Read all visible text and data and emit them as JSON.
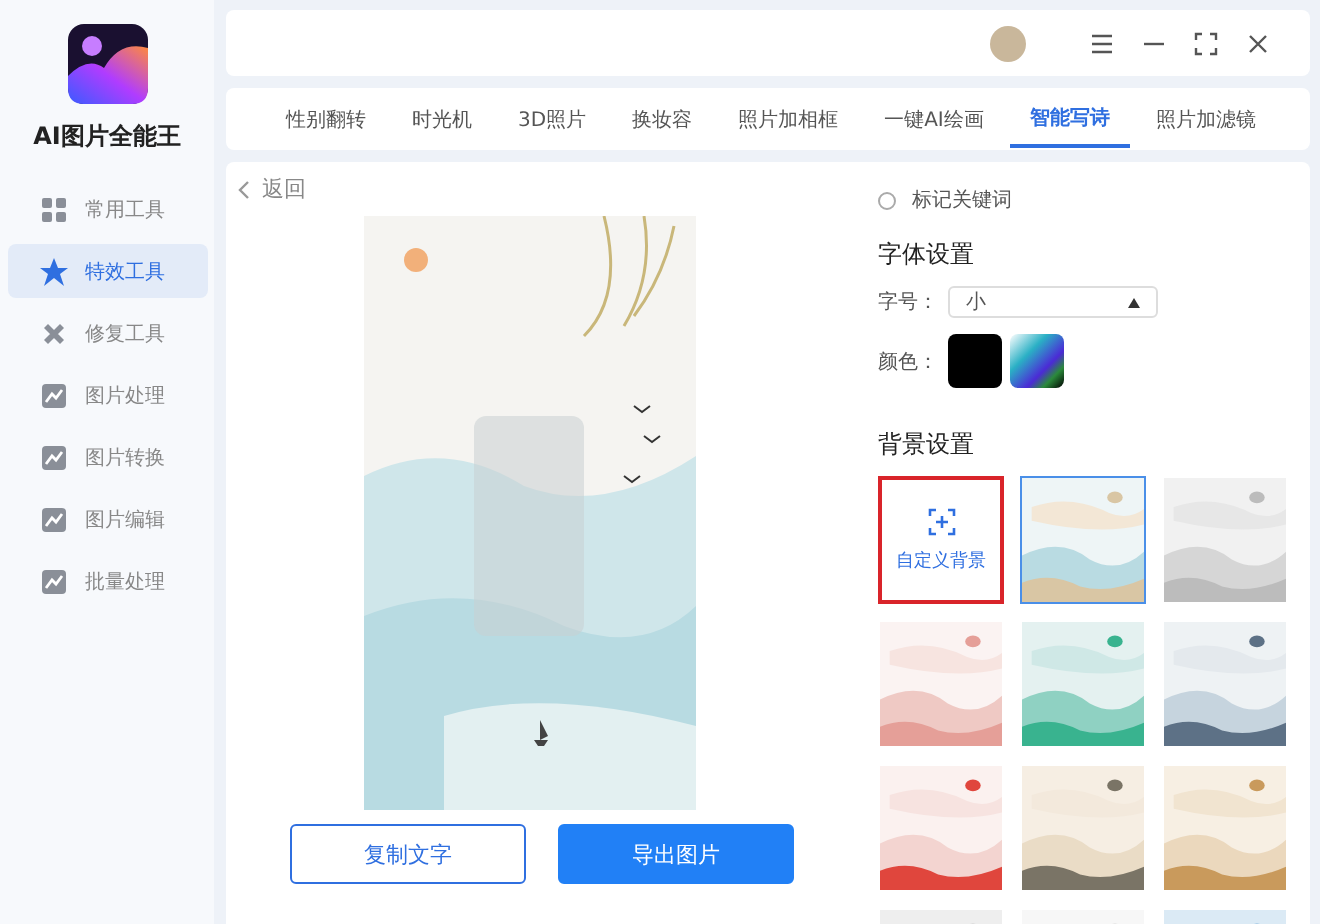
{
  "app": {
    "title": "AI图片全能王"
  },
  "sidebar": {
    "items": [
      {
        "label": "常用工具",
        "selected": false
      },
      {
        "label": "特效工具",
        "selected": true
      },
      {
        "label": "修复工具",
        "selected": false
      },
      {
        "label": "图片处理",
        "selected": false
      },
      {
        "label": "图片转换",
        "selected": false
      },
      {
        "label": "图片编辑",
        "selected": false
      },
      {
        "label": "批量处理",
        "selected": false
      }
    ]
  },
  "tabs": [
    {
      "label": "性别翻转",
      "selected": false
    },
    {
      "label": "时光机",
      "selected": false
    },
    {
      "label": "3D照片",
      "selected": false
    },
    {
      "label": "换妆容",
      "selected": false
    },
    {
      "label": "照片加相框",
      "selected": false
    },
    {
      "label": "一键AI绘画",
      "selected": false
    },
    {
      "label": "智能写诗",
      "selected": true
    },
    {
      "label": "照片加滤镜",
      "selected": false
    }
  ],
  "back": {
    "label": "返回"
  },
  "actions": [
    {
      "label": "复制文字",
      "kind": "outline"
    },
    {
      "label": "导出图片",
      "kind": "primary"
    }
  ],
  "keyword_option": {
    "label": "标记关键词",
    "checked": false
  },
  "font_settings": {
    "heading": "字体设置",
    "size_label": "字号：",
    "size_value": "小",
    "color_label": "颜色：",
    "color": "#000000"
  },
  "background_settings": {
    "heading": "背景设置",
    "custom": {
      "label": "自定义背景",
      "selected": false
    },
    "thumbnails": [
      {
        "selected": true
      },
      {
        "selected": false
      },
      {
        "selected": false
      },
      {
        "selected": false
      },
      {
        "selected": false
      },
      {
        "selected": false
      },
      {
        "selected": false
      },
      {
        "selected": false
      },
      {
        "selected": false
      },
      {
        "selected": false
      },
      {
        "selected": false
      }
    ]
  }
}
